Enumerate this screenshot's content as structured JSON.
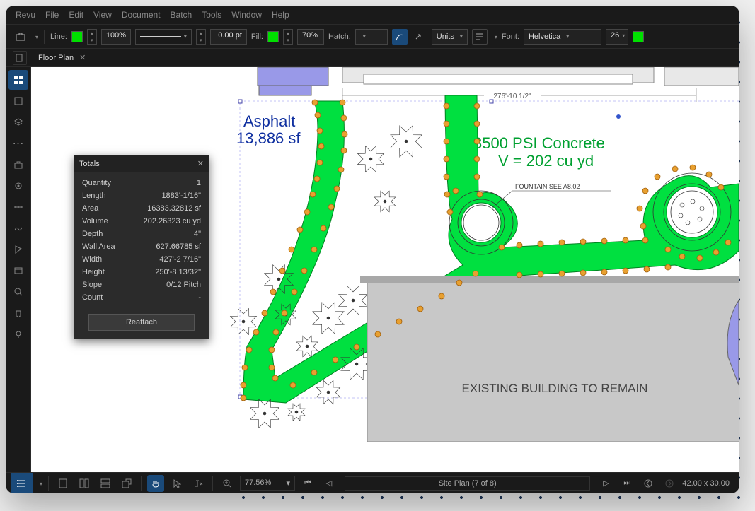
{
  "menu": [
    "Revu",
    "File",
    "Edit",
    "View",
    "Document",
    "Batch",
    "Tools",
    "Window",
    "Help"
  ],
  "toolbar": {
    "line_label": "Line:",
    "line_width_pct": "100%",
    "pt_val": "0.00 pt",
    "fill_label": "Fill:",
    "fill_pct": "70%",
    "hatch_label": "Hatch:",
    "units_label": "Units",
    "font_label": "Font:",
    "font_value": "Helvetica",
    "font_size": "26"
  },
  "tab": {
    "title": "Floor Plan"
  },
  "totals": {
    "title": "Totals",
    "rows": [
      {
        "k": "Quantity",
        "v": "1"
      },
      {
        "k": "Length",
        "v": "1883'-1/16\""
      },
      {
        "k": "Area",
        "v": "16383.32812 sf"
      },
      {
        "k": "Volume",
        "v": "202.26323 cu yd"
      },
      {
        "k": "Depth",
        "v": "4\""
      },
      {
        "k": "Wall Area",
        "v": "627.66785 sf"
      },
      {
        "k": "Width",
        "v": "427'-2 7/16\""
      },
      {
        "k": "Height",
        "v": "250'-8 13/32\""
      },
      {
        "k": "Slope",
        "v": "0/12 Pitch"
      },
      {
        "k": "Count",
        "v": "-"
      }
    ],
    "reattach": "Reattach"
  },
  "status": {
    "zoom": "77.56%",
    "page": "Site Plan (7 of 8)",
    "dim": "42.00 x 30.00"
  },
  "drawing": {
    "asphalt_label": "Asphalt",
    "asphalt_val": "13,886 sf",
    "concrete_label": "3500 PSI Concrete",
    "concrete_val": "V = 202 cu yd",
    "fountain_label": "FOUNTAIN SEE A8.02",
    "dim_top": "276'-10 1/2\"",
    "existing": "EXISTING BUILDING TO REMAIN"
  }
}
